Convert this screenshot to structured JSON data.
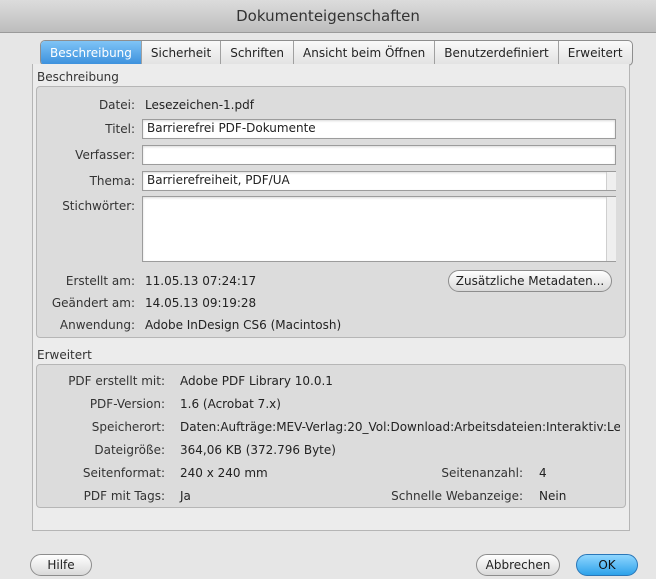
{
  "window": {
    "title": "Dokumenteigenschaften"
  },
  "tabs": [
    "Beschreibung",
    "Sicherheit",
    "Schriften",
    "Ansicht beim Öffnen",
    "Benutzerdefiniert",
    "Erweitert"
  ],
  "description": {
    "section_label": "Beschreibung",
    "file_label": "Datei:",
    "file_value": "Lesezeichen-1.pdf",
    "title_label": "Titel:",
    "title_value": "Barrierefrei PDF-Dokumente",
    "author_label": "Verfasser:",
    "author_value": "",
    "subject_label": "Thema:",
    "subject_value": "Barrierefreiheit, PDF/UA",
    "keywords_label": "Stichwörter:",
    "keywords_value": "",
    "created_label": "Erstellt am:",
    "created_value": "11.05.13 07:24:17",
    "modified_label": "Geändert am:",
    "modified_value": "14.05.13 09:19:28",
    "app_label": "Anwendung:",
    "app_value": "Adobe InDesign CS6 (Macintosh)",
    "metadata_button": "Zusätzliche Metadaten..."
  },
  "advanced": {
    "section_label": "Erweitert",
    "producer_label": "PDF erstellt mit:",
    "producer_value": "Adobe PDF Library 10.0.1",
    "version_label": "PDF-Version:",
    "version_value": "1.6 (Acrobat 7.x)",
    "location_label": "Speicherort:",
    "location_value": "Daten:Aufträge:MEV-Verlag:20_Vol:Download:Arbeitsdateien:Interaktiv:Le...",
    "size_label": "Dateigröße:",
    "size_value": "364,06 KB (372.796 Byte)",
    "pagesize_label": "Seitenformat:",
    "pagesize_value": "240 x 240 mm",
    "pages_label": "Seitenanzahl:",
    "pages_value": "4",
    "tagged_label": "PDF mit Tags:",
    "tagged_value": "Ja",
    "fastweb_label": "Schnelle Webanzeige:",
    "fastweb_value": "Nein"
  },
  "buttons": {
    "help": "Hilfe",
    "cancel": "Abbrechen",
    "ok": "OK"
  }
}
